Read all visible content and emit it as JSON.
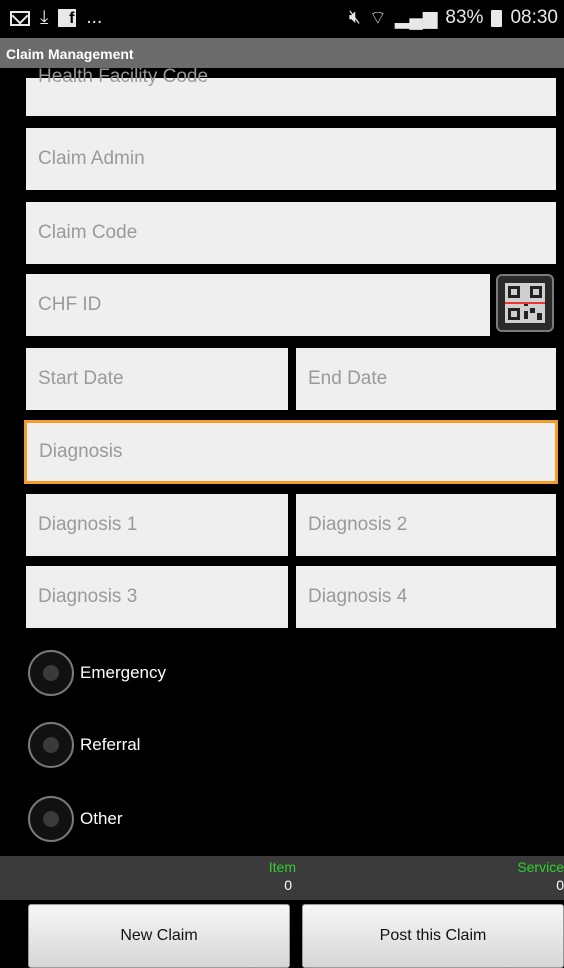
{
  "status_bar": {
    "left_icons": [
      "mail-icon",
      "download-icon",
      "facebook-icon"
    ],
    "ellipsis": "...",
    "battery_percent": "83%",
    "time": "08:30",
    "right_icons": [
      "mute-icon",
      "wifi-icon",
      "signal-icon",
      "battery-icon"
    ]
  },
  "app": {
    "title": "Claim Management"
  },
  "form": {
    "health_facility_code": {
      "placeholder": "Health Facility Code"
    },
    "claim_admin": {
      "placeholder": "Claim Admin"
    },
    "claim_code": {
      "placeholder": "Claim Code"
    },
    "chf_id": {
      "placeholder": "CHF ID"
    },
    "start_date": {
      "placeholder": "Start Date"
    },
    "end_date": {
      "placeholder": "End Date"
    },
    "diagnosis": {
      "placeholder": "Diagnosis"
    },
    "diagnosis_1": {
      "placeholder": "Diagnosis 1"
    },
    "diagnosis_2": {
      "placeholder": "Diagnosis 2"
    },
    "diagnosis_3": {
      "placeholder": "Diagnosis 3"
    },
    "diagnosis_4": {
      "placeholder": "Diagnosis 4"
    }
  },
  "visit_type": {
    "options": [
      {
        "label": "Emergency",
        "selected": false
      },
      {
        "label": "Referral",
        "selected": false
      },
      {
        "label": "Other",
        "selected": false
      }
    ]
  },
  "counts": {
    "item_label": "Item",
    "item_value": "0",
    "service_label": "Service",
    "service_value": "0"
  },
  "buttons": {
    "new_claim": "New Claim",
    "post_claim": "Post this Claim"
  },
  "colors": {
    "focus_border": "#f39c2b",
    "count_label": "#2fd12f",
    "title_bar": "#6b6b6b"
  }
}
